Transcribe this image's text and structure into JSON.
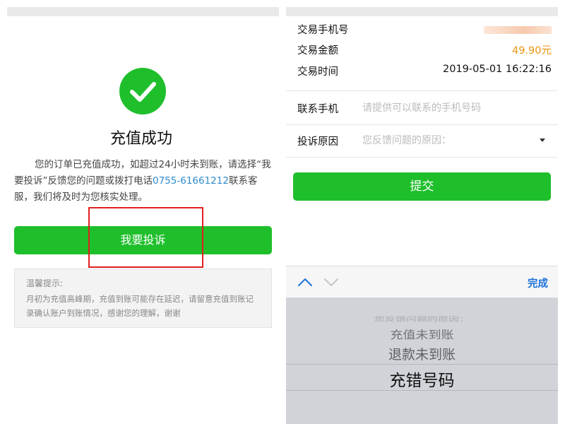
{
  "left": {
    "title": "充值成功",
    "description_prefix": "您的订单已充值成功，如超过24小时未到账，请选择“我要投诉”反馈您的问题或拨打电话",
    "phone": "0755-61661212",
    "description_suffix": "联系客服，我们将及时为您核实处理。",
    "complain_label": "我要投诉",
    "tip_title": "温馨提示:",
    "tip_text": "月初为充值高峰期，充值到账可能存在延迟，请留意充值到账记录确认账户到账情况，感谢您的理解，谢谢"
  },
  "right": {
    "info": {
      "phone_label": "交易手机号",
      "amount_label": "交易金额",
      "amount_value": "49.90元",
      "time_label": "交易时间",
      "time_value": "2019-05-01 16:22:16"
    },
    "form": {
      "contact_label": "联系手机",
      "contact_placeholder": "请提供可以联系的手机号码",
      "reason_label": "投诉原因",
      "reason_placeholder": "您反馈问题的原因："
    },
    "submit_label": "提交",
    "picker": {
      "done_label": "完成",
      "options": [
        "您反馈问题的原因：",
        "充值未到账",
        "退款未到账",
        "充错号码"
      ],
      "selected": "充错号码"
    }
  },
  "colors": {
    "primary_green": "#1fbf2c",
    "link_blue": "#2e8bcc",
    "amount_orange": "#e8960f",
    "highlight_red": "#e02020"
  }
}
